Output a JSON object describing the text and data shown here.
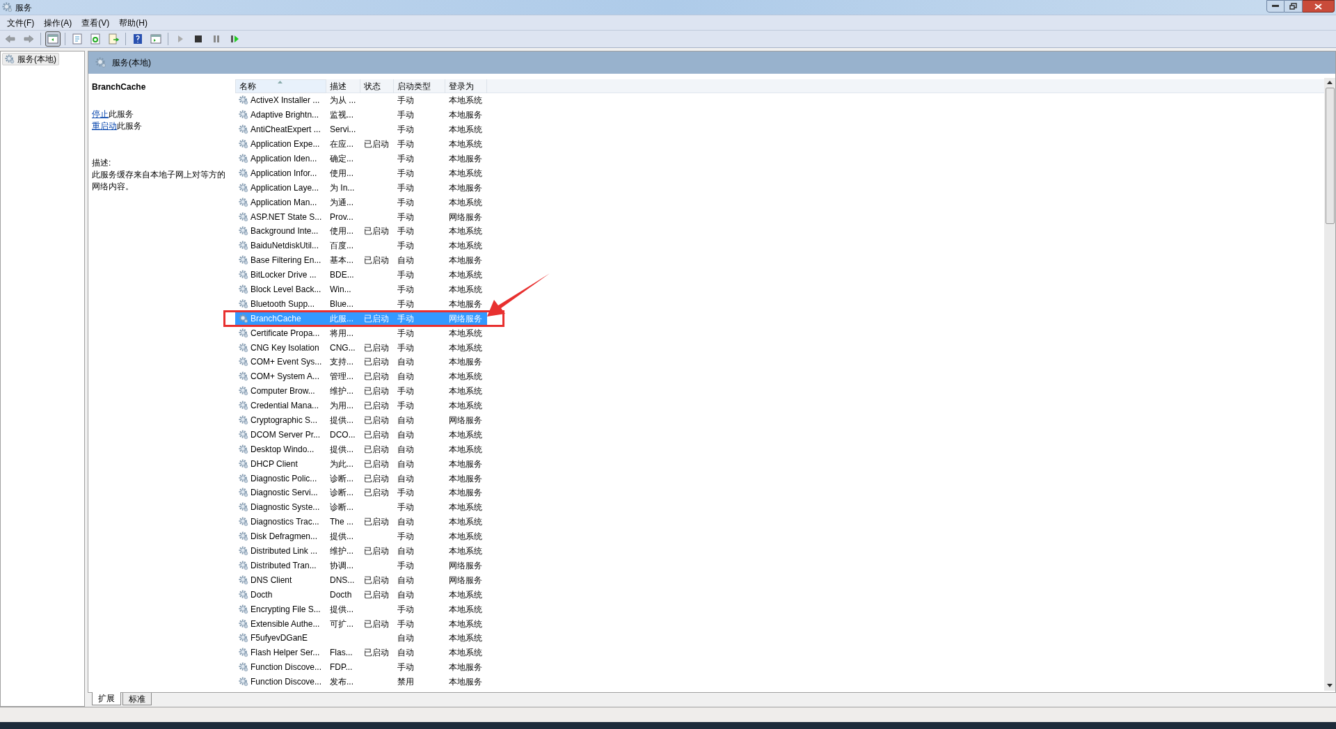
{
  "window": {
    "title": "服务"
  },
  "menu": [
    "文件(F)",
    "操作(A)",
    "查看(V)",
    "帮助(H)"
  ],
  "tree": {
    "items": [
      {
        "label": "服务(本地)",
        "selected": true
      }
    ]
  },
  "pane_header": "服务(本地)",
  "details": {
    "title": "BranchCache",
    "actions": [
      {
        "link": "停止",
        "text": "此服务"
      },
      {
        "link": "重启动",
        "text": "此服务"
      }
    ],
    "description_label": "描述:",
    "description": "此服务缓存来自本地子网上对等方的网络内容。"
  },
  "table": {
    "columns": [
      "名称",
      "描述",
      "状态",
      "启动类型",
      "登录为"
    ],
    "rows": [
      {
        "name": "ActiveX Installer ...",
        "desc": "为从 ...",
        "status": "",
        "startup": "手动",
        "logon": "本地系统",
        "selected": false
      },
      {
        "name": "Adaptive Brightn...",
        "desc": "监视...",
        "status": "",
        "startup": "手动",
        "logon": "本地服务",
        "selected": false
      },
      {
        "name": "AntiCheatExpert ...",
        "desc": "Servi...",
        "status": "",
        "startup": "手动",
        "logon": "本地系统",
        "selected": false
      },
      {
        "name": "Application Expe...",
        "desc": "在应...",
        "status": "已启动",
        "startup": "手动",
        "logon": "本地系统",
        "selected": false
      },
      {
        "name": "Application Iden...",
        "desc": "确定...",
        "status": "",
        "startup": "手动",
        "logon": "本地服务",
        "selected": false
      },
      {
        "name": "Application Infor...",
        "desc": "使用...",
        "status": "",
        "startup": "手动",
        "logon": "本地系统",
        "selected": false
      },
      {
        "name": "Application Laye...",
        "desc": "为 In...",
        "status": "",
        "startup": "手动",
        "logon": "本地服务",
        "selected": false
      },
      {
        "name": "Application Man...",
        "desc": "为通...",
        "status": "",
        "startup": "手动",
        "logon": "本地系统",
        "selected": false
      },
      {
        "name": "ASP.NET State S...",
        "desc": "Prov...",
        "status": "",
        "startup": "手动",
        "logon": "网络服务",
        "selected": false
      },
      {
        "name": "Background Inte...",
        "desc": "使用...",
        "status": "已启动",
        "startup": "手动",
        "logon": "本地系统",
        "selected": false
      },
      {
        "name": "BaiduNetdiskUtil...",
        "desc": "百度...",
        "status": "",
        "startup": "手动",
        "logon": "本地系统",
        "selected": false
      },
      {
        "name": "Base Filtering En...",
        "desc": "基本...",
        "status": "已启动",
        "startup": "自动",
        "logon": "本地服务",
        "selected": false
      },
      {
        "name": "BitLocker Drive ...",
        "desc": "BDE...",
        "status": "",
        "startup": "手动",
        "logon": "本地系统",
        "selected": false
      },
      {
        "name": "Block Level Back...",
        "desc": "Win...",
        "status": "",
        "startup": "手动",
        "logon": "本地系统",
        "selected": false
      },
      {
        "name": "Bluetooth Supp...",
        "desc": "Blue...",
        "status": "",
        "startup": "手动",
        "logon": "本地服务",
        "selected": false
      },
      {
        "name": "BranchCache",
        "desc": "此服...",
        "status": "已启动",
        "startup": "手动",
        "logon": "网络服务",
        "selected": true
      },
      {
        "name": "Certificate Propa...",
        "desc": "将用...",
        "status": "",
        "startup": "手动",
        "logon": "本地系统",
        "selected": false
      },
      {
        "name": "CNG Key Isolation",
        "desc": "CNG...",
        "status": "已启动",
        "startup": "手动",
        "logon": "本地系统",
        "selected": false
      },
      {
        "name": "COM+ Event Sys...",
        "desc": "支持...",
        "status": "已启动",
        "startup": "自动",
        "logon": "本地服务",
        "selected": false
      },
      {
        "name": "COM+ System A...",
        "desc": "管理...",
        "status": "已启动",
        "startup": "自动",
        "logon": "本地系统",
        "selected": false
      },
      {
        "name": "Computer Brow...",
        "desc": "维护...",
        "status": "已启动",
        "startup": "手动",
        "logon": "本地系统",
        "selected": false
      },
      {
        "name": "Credential Mana...",
        "desc": "为用...",
        "status": "已启动",
        "startup": "手动",
        "logon": "本地系统",
        "selected": false
      },
      {
        "name": "Cryptographic S...",
        "desc": "提供...",
        "status": "已启动",
        "startup": "自动",
        "logon": "网络服务",
        "selected": false
      },
      {
        "name": "DCOM Server Pr...",
        "desc": "DCO...",
        "status": "已启动",
        "startup": "自动",
        "logon": "本地系统",
        "selected": false
      },
      {
        "name": "Desktop Windo...",
        "desc": "提供...",
        "status": "已启动",
        "startup": "自动",
        "logon": "本地系统",
        "selected": false
      },
      {
        "name": "DHCP Client",
        "desc": "为此...",
        "status": "已启动",
        "startup": "自动",
        "logon": "本地服务",
        "selected": false
      },
      {
        "name": "Diagnostic Polic...",
        "desc": "诊断...",
        "status": "已启动",
        "startup": "自动",
        "logon": "本地服务",
        "selected": false
      },
      {
        "name": "Diagnostic Servi...",
        "desc": "诊断...",
        "status": "已启动",
        "startup": "手动",
        "logon": "本地服务",
        "selected": false
      },
      {
        "name": "Diagnostic Syste...",
        "desc": "诊断...",
        "status": "",
        "startup": "手动",
        "logon": "本地系统",
        "selected": false
      },
      {
        "name": "Diagnostics Trac...",
        "desc": "The ...",
        "status": "已启动",
        "startup": "自动",
        "logon": "本地系统",
        "selected": false
      },
      {
        "name": "Disk Defragmen...",
        "desc": "提供...",
        "status": "",
        "startup": "手动",
        "logon": "本地系统",
        "selected": false
      },
      {
        "name": "Distributed Link ...",
        "desc": "维护...",
        "status": "已启动",
        "startup": "自动",
        "logon": "本地系统",
        "selected": false
      },
      {
        "name": "Distributed Tran...",
        "desc": "协调...",
        "status": "",
        "startup": "手动",
        "logon": "网络服务",
        "selected": false
      },
      {
        "name": "DNS Client",
        "desc": "DNS...",
        "status": "已启动",
        "startup": "自动",
        "logon": "网络服务",
        "selected": false
      },
      {
        "name": "Docth",
        "desc": "Docth",
        "status": "已启动",
        "startup": "自动",
        "logon": "本地系统",
        "selected": false
      },
      {
        "name": "Encrypting File S...",
        "desc": "提供...",
        "status": "",
        "startup": "手动",
        "logon": "本地系统",
        "selected": false
      },
      {
        "name": "Extensible Authe...",
        "desc": "可扩...",
        "status": "已启动",
        "startup": "手动",
        "logon": "本地系统",
        "selected": false
      },
      {
        "name": "F5ufyevDGanE",
        "desc": "",
        "status": "",
        "startup": "自动",
        "logon": "本地系统",
        "selected": false
      },
      {
        "name": "Flash Helper Ser...",
        "desc": "Flas...",
        "status": "已启动",
        "startup": "自动",
        "logon": "本地系统",
        "selected": false
      },
      {
        "name": "Function Discove...",
        "desc": "FDP...",
        "status": "",
        "startup": "手动",
        "logon": "本地服务",
        "selected": false
      },
      {
        "name": "Function Discove...",
        "desc": "发布...",
        "status": "",
        "startup": "禁用",
        "logon": "本地服务",
        "selected": false
      }
    ]
  },
  "view_tabs": [
    {
      "label": "扩展",
      "selected": true
    },
    {
      "label": "标准",
      "selected": false
    }
  ]
}
